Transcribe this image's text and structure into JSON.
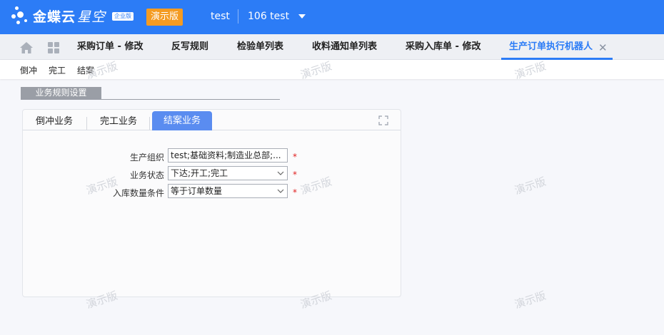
{
  "header": {
    "logo_text": "金蝶云",
    "logo_sub": "星空",
    "edition": "企业版",
    "demo_badge": "演示版",
    "user": "test",
    "org": "106  test"
  },
  "tabs": [
    {
      "label": "采购订单 - 修改"
    },
    {
      "label": "反写规则"
    },
    {
      "label": "检验单列表"
    },
    {
      "label": "收料通知单列表"
    },
    {
      "label": "采购入库单 - 修改"
    },
    {
      "label": "生产订单执行机器人"
    }
  ],
  "active_tab_close": "✕",
  "toolbar": {
    "items": [
      "倒冲",
      "完工",
      "结案"
    ]
  },
  "section": {
    "title": "业务规则设置"
  },
  "panel": {
    "tabs": [
      "倒冲业务",
      "完工业务",
      "结案业务"
    ],
    "active_tab": "结案业务"
  },
  "form": {
    "fields": [
      {
        "label": "生产组织",
        "value": "test;基础资料;制造业总部;...",
        "required": "*"
      },
      {
        "label": "业务状态",
        "value": "下达;开工;完工",
        "required": "*"
      },
      {
        "label": "入库数量条件",
        "value": "等于订单数量",
        "required": "*"
      }
    ]
  },
  "watermark": "演示版",
  "colors": {
    "brand_blue": "#2c7cf6",
    "badge_orange": "#f49b22",
    "active_inner_tab": "#5a8cf0",
    "required_red": "#e02020"
  }
}
